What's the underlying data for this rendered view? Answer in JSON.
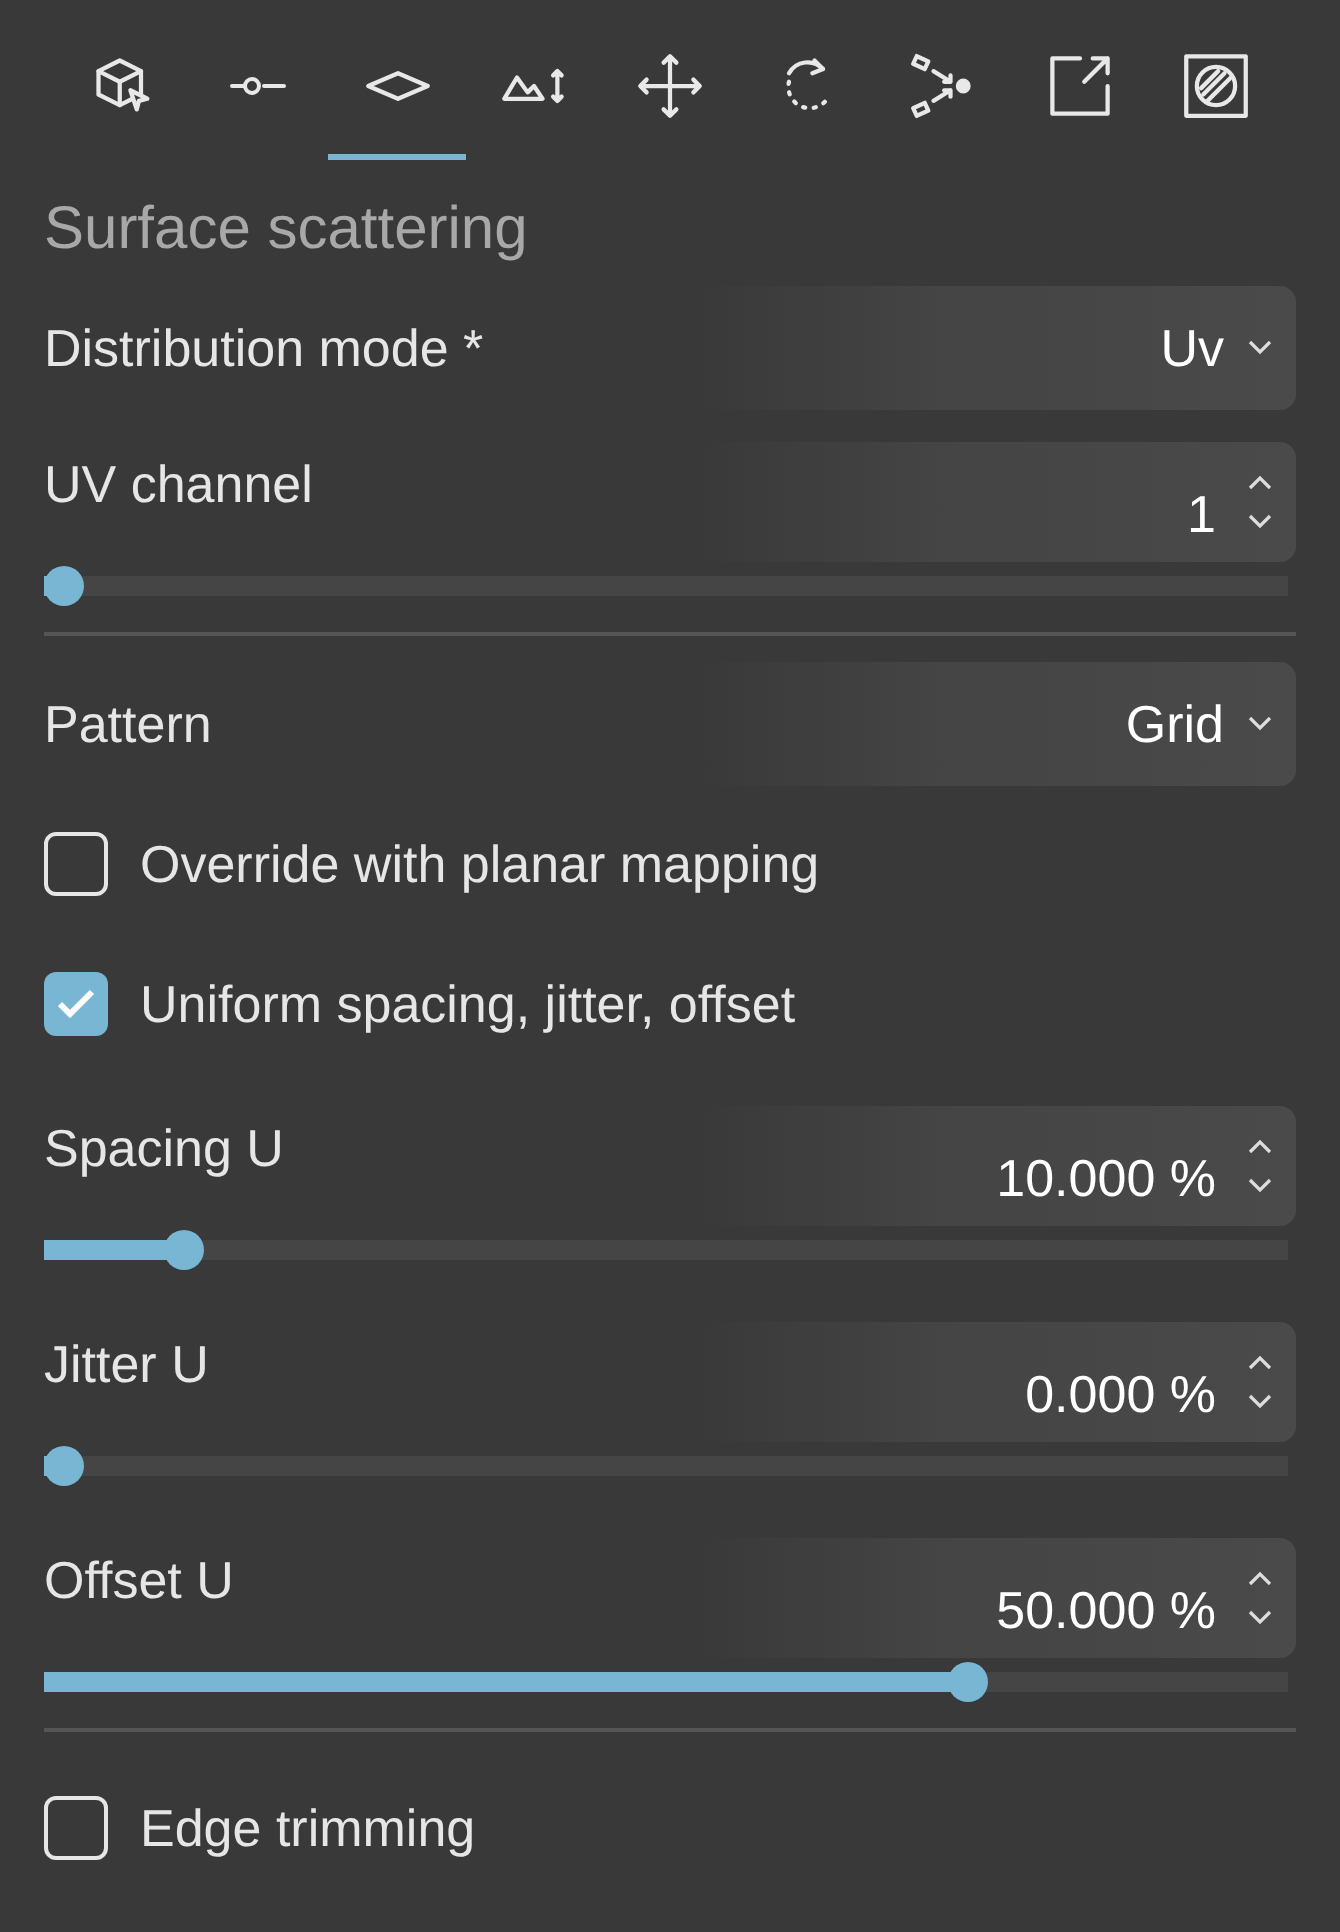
{
  "toolbar": [
    {
      "kind": "cube-cursor",
      "selected": false
    },
    {
      "kind": "point-line",
      "selected": false
    },
    {
      "kind": "plane",
      "selected": true
    },
    {
      "kind": "terrain-height",
      "selected": false
    },
    {
      "kind": "move",
      "selected": false
    },
    {
      "kind": "rotate",
      "selected": false
    },
    {
      "kind": "converge",
      "selected": false
    },
    {
      "kind": "export",
      "selected": false
    },
    {
      "kind": "hatch",
      "selected": false
    }
  ],
  "title": "Surface scattering",
  "items": [
    {
      "kind": "dropdown",
      "label": "Distribution mode *",
      "value": "Uv"
    },
    {
      "kind": "number_slider",
      "label": "UV channel",
      "value": "1",
      "level": 0
    },
    {
      "kind": "divider"
    },
    {
      "kind": "dropdown",
      "label": "Pattern",
      "value": "Grid"
    },
    {
      "kind": "checkbox",
      "label": "Override with planar mapping",
      "checked": false
    },
    {
      "kind": "checkbox",
      "label": "Uniform spacing, jitter, offset",
      "checked": true
    },
    {
      "kind": "number_slider",
      "label": "Spacing U",
      "value": "10.000 %",
      "level": 0.1
    },
    {
      "kind": "number_slider",
      "label": "Jitter U",
      "value": "0.000 %",
      "level": 0
    },
    {
      "kind": "number_slider",
      "label": "Offset U",
      "value": "50.000 %",
      "level": 0.75
    },
    {
      "kind": "divider"
    },
    {
      "kind": "checkbox",
      "label": "Edge trimming",
      "checked": false
    }
  ]
}
